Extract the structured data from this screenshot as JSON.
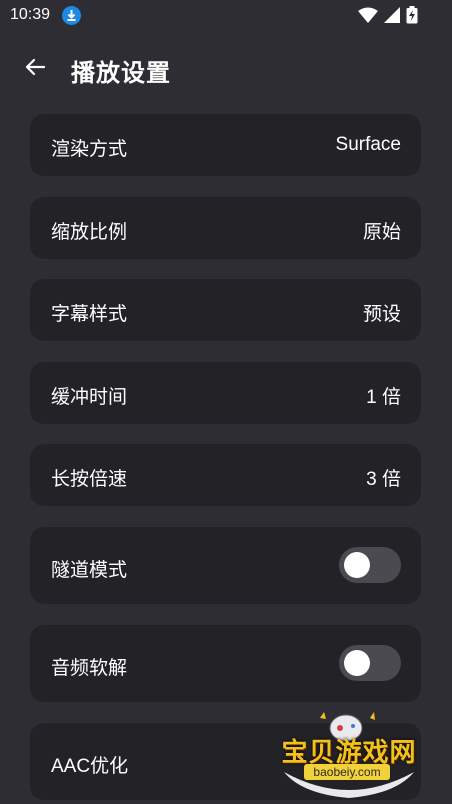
{
  "status_bar": {
    "time": "10:39",
    "icons": [
      "download-icon",
      "wifi-icon",
      "signal-icon",
      "battery-charging-icon"
    ]
  },
  "app_bar": {
    "back_icon": "arrow-left-icon",
    "title": "播放设置"
  },
  "settings": {
    "render_mode": {
      "label": "渲染方式",
      "value": "Surface"
    },
    "scale_ratio": {
      "label": "缩放比例",
      "value": "原始"
    },
    "subtitle_style": {
      "label": "字幕样式",
      "value": "预设"
    },
    "buffer_time": {
      "label": "缓冲时间",
      "value": "1 倍"
    },
    "long_press_speed": {
      "label": "长按倍速",
      "value": "3 倍"
    },
    "tunnel_mode": {
      "label": "隧道模式",
      "enabled": false
    },
    "audio_soft_decode": {
      "label": "音频软解",
      "enabled": false
    },
    "aac_optimize": {
      "label": "AAC优化"
    }
  },
  "watermark": {
    "text": "宝贝游戏网",
    "domain": "baobeiy.com"
  },
  "colors": {
    "background": "#2e2d33",
    "card": "#232227",
    "toggle_off_track": "#4b4a50",
    "toggle_knob": "#ffffff",
    "download_badge": "#1e88e5"
  }
}
